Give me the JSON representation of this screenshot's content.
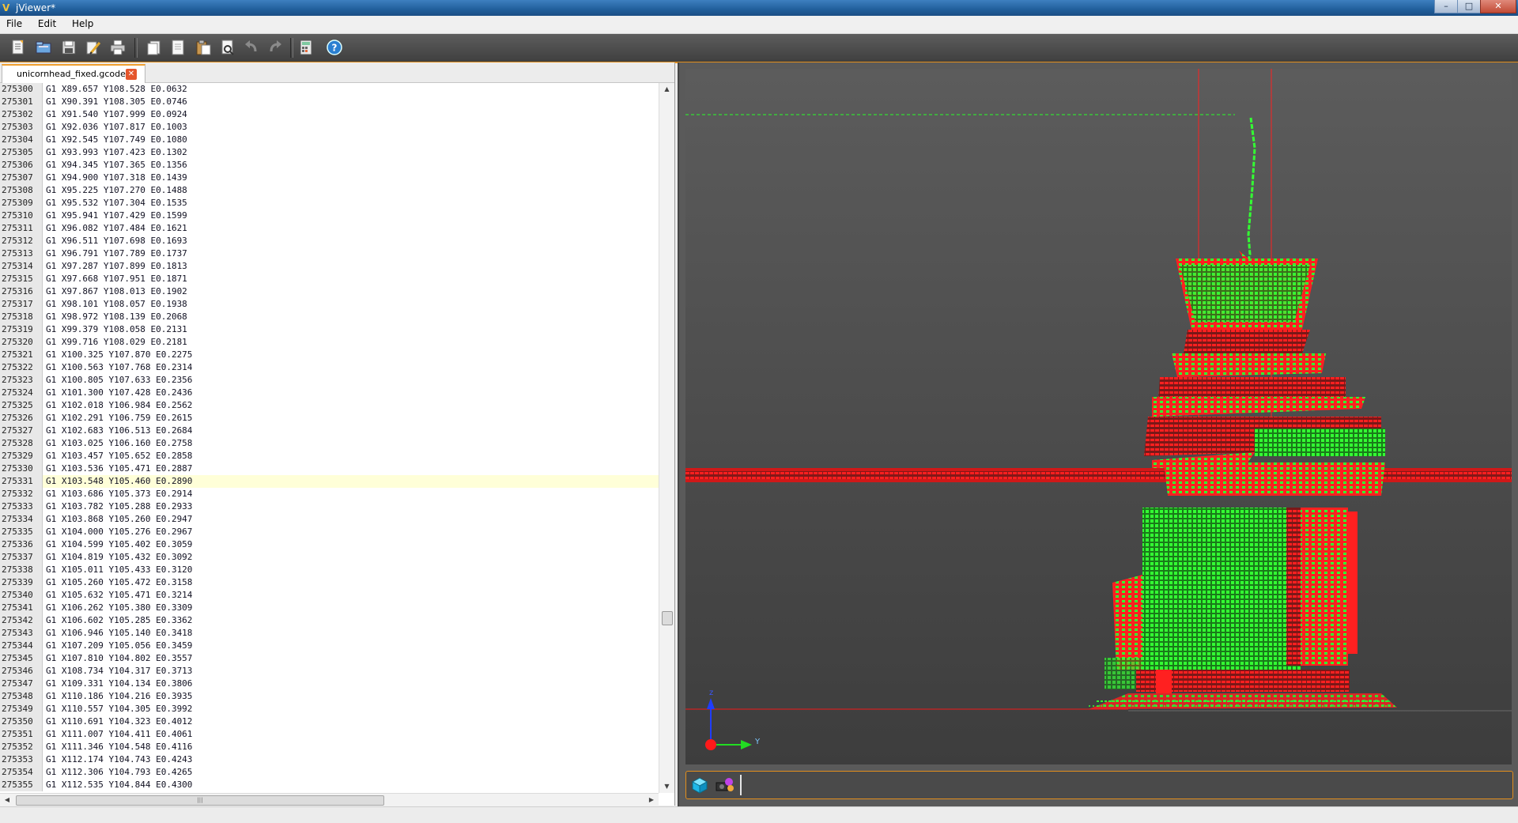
{
  "window": {
    "title": "jViewer*"
  },
  "menu": [
    "File",
    "Edit",
    "Help"
  ],
  "toolbar": {
    "icons": [
      "new-file-icon",
      "open-folder-icon",
      "save-icon",
      "edit-icon",
      "print-icon",
      "copy-page-icon",
      "page-icon",
      "paste-icon",
      "find-icon",
      "undo-icon",
      "redo-icon",
      "calculator-icon",
      "help-icon"
    ],
    "colors": {
      "accent": "#e28e1c",
      "background": "#4a4a4a"
    }
  },
  "editor": {
    "tab_label": "unicornhead_fixed.gcode",
    "current_line": 275331,
    "lines": [
      [
        "275300",
        "G1 X89.657 Y108.528 E0.0632"
      ],
      [
        "275301",
        "G1 X90.391 Y108.305 E0.0746"
      ],
      [
        "275302",
        "G1 X91.540 Y107.999 E0.0924"
      ],
      [
        "275303",
        "G1 X92.036 Y107.817 E0.1003"
      ],
      [
        "275304",
        "G1 X92.545 Y107.749 E0.1080"
      ],
      [
        "275305",
        "G1 X93.993 Y107.423 E0.1302"
      ],
      [
        "275306",
        "G1 X94.345 Y107.365 E0.1356"
      ],
      [
        "275307",
        "G1 X94.900 Y107.318 E0.1439"
      ],
      [
        "275308",
        "G1 X95.225 Y107.270 E0.1488"
      ],
      [
        "275309",
        "G1 X95.532 Y107.304 E0.1535"
      ],
      [
        "275310",
        "G1 X95.941 Y107.429 E0.1599"
      ],
      [
        "275311",
        "G1 X96.082 Y107.484 E0.1621"
      ],
      [
        "275312",
        "G1 X96.511 Y107.698 E0.1693"
      ],
      [
        "275313",
        "G1 X96.791 Y107.789 E0.1737"
      ],
      [
        "275314",
        "G1 X97.287 Y107.899 E0.1813"
      ],
      [
        "275315",
        "G1 X97.668 Y107.951 E0.1871"
      ],
      [
        "275316",
        "G1 X97.867 Y108.013 E0.1902"
      ],
      [
        "275317",
        "G1 X98.101 Y108.057 E0.1938"
      ],
      [
        "275318",
        "G1 X98.972 Y108.139 E0.2068"
      ],
      [
        "275319",
        "G1 X99.379 Y108.058 E0.2131"
      ],
      [
        "275320",
        "G1 X99.716 Y108.029 E0.2181"
      ],
      [
        "275321",
        "G1 X100.325 Y107.870 E0.2275"
      ],
      [
        "275322",
        "G1 X100.563 Y107.768 E0.2314"
      ],
      [
        "275323",
        "G1 X100.805 Y107.633 E0.2356"
      ],
      [
        "275324",
        "G1 X101.300 Y107.428 E0.2436"
      ],
      [
        "275325",
        "G1 X102.018 Y106.984 E0.2562"
      ],
      [
        "275326",
        "G1 X102.291 Y106.759 E0.2615"
      ],
      [
        "275327",
        "G1 X102.683 Y106.513 E0.2684"
      ],
      [
        "275328",
        "G1 X103.025 Y106.160 E0.2758"
      ],
      [
        "275329",
        "G1 X103.457 Y105.652 E0.2858"
      ],
      [
        "275330",
        "G1 X103.536 Y105.471 E0.2887"
      ],
      [
        "275331",
        "G1 X103.548 Y105.460 E0.2890"
      ],
      [
        "275332",
        "G1 X103.686 Y105.373 E0.2914"
      ],
      [
        "275333",
        "G1 X103.782 Y105.288 E0.2933"
      ],
      [
        "275334",
        "G1 X103.868 Y105.260 E0.2947"
      ],
      [
        "275335",
        "G1 X104.000 Y105.276 E0.2967"
      ],
      [
        "275336",
        "G1 X104.599 Y105.402 E0.3059"
      ],
      [
        "275337",
        "G1 X104.819 Y105.432 E0.3092"
      ],
      [
        "275338",
        "G1 X105.011 Y105.433 E0.3120"
      ],
      [
        "275339",
        "G1 X105.260 Y105.472 E0.3158"
      ],
      [
        "275340",
        "G1 X105.632 Y105.471 E0.3214"
      ],
      [
        "275341",
        "G1 X106.262 Y105.380 E0.3309"
      ],
      [
        "275342",
        "G1 X106.602 Y105.285 E0.3362"
      ],
      [
        "275343",
        "G1 X106.946 Y105.140 E0.3418"
      ],
      [
        "275344",
        "G1 X107.209 Y105.056 E0.3459"
      ],
      [
        "275345",
        "G1 X107.810 Y104.802 E0.3557"
      ],
      [
        "275346",
        "G1 X108.734 Y104.317 E0.3713"
      ],
      [
        "275347",
        "G1 X109.331 Y104.134 E0.3806"
      ],
      [
        "275348",
        "G1 X110.186 Y104.216 E0.3935"
      ],
      [
        "275349",
        "G1 X110.557 Y104.305 E0.3992"
      ],
      [
        "275350",
        "G1 X110.691 Y104.323 E0.4012"
      ],
      [
        "275351",
        "G1 X111.007 Y104.411 E0.4061"
      ],
      [
        "275352",
        "G1 X111.346 Y104.548 E0.4116"
      ],
      [
        "275353",
        "G1 X112.174 Y104.743 E0.4243"
      ],
      [
        "275354",
        "G1 X112.306 Y104.793 E0.4265"
      ],
      [
        "275355",
        "G1 X112.535 Y104.844 E0.4300"
      ]
    ]
  },
  "viewer": {
    "axis_labels": {
      "z": "z",
      "y": "Y"
    },
    "colors": {
      "background": "#5a5a5a",
      "extrusion": "#33ff33",
      "travel": "#ff1a1a",
      "z_axis": "#1f3dff",
      "y_axis": "#22dd22",
      "x_axis": "#ff2020"
    },
    "bottom_icons": [
      "cube-view-icon",
      "camera-icon"
    ]
  }
}
